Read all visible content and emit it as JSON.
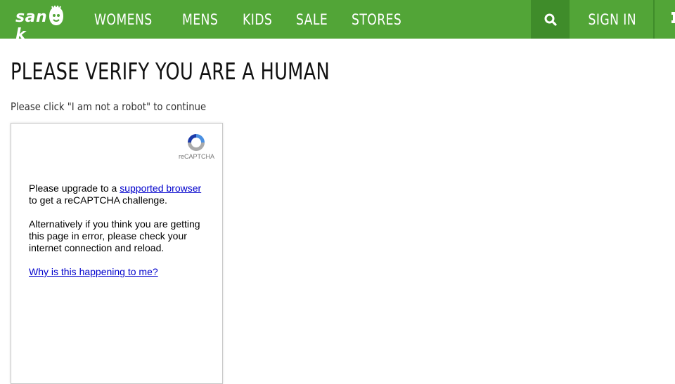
{
  "header": {
    "logo_text": "san",
    "logo_suffix": "k",
    "nav": [
      {
        "label": "WOMENS"
      },
      {
        "label": "MENS"
      },
      {
        "label": "KIDS"
      },
      {
        "label": "SALE"
      },
      {
        "label": "STORES"
      }
    ],
    "search_icon": "search-icon",
    "sign_in_label": "SIGN IN",
    "cart_icon": "cart-icon"
  },
  "main": {
    "title": "PLEASE VERIFY YOU ARE A HUMAN",
    "subtitle": "Please click \"I am not a robot\" to continue"
  },
  "captcha": {
    "brand_label": "reCAPTCHA",
    "upgrade_prefix": "Please upgrade to a ",
    "upgrade_link": "supported browser",
    "upgrade_suffix": "to get a reCAPTCHA challenge.",
    "alternative_text": "Alternatively if you think you are getting this page in error, please check your internet connection and reload.",
    "why_link": "Why is this happening to me?"
  },
  "colors": {
    "header_green": "#52a537",
    "header_dark_green": "#3f8c2a",
    "link_blue": "#0000cc"
  }
}
